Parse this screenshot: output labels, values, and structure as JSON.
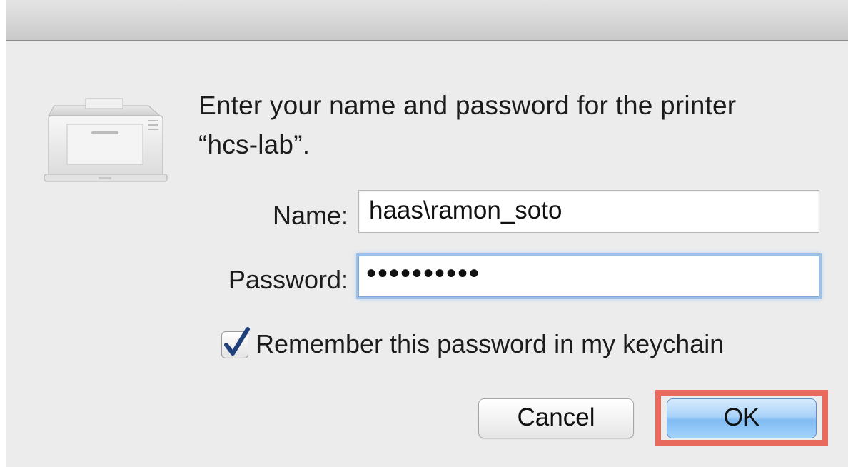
{
  "dialog": {
    "message_line1": "Enter your name and password for the printer",
    "message_line2": "“hcs-lab”."
  },
  "form": {
    "name_label": "Name:",
    "name_value": "haas\\ramon_soto",
    "password_label": "Password:",
    "password_value": "••••••••••",
    "remember_label": "Remember this password in my keychain",
    "remember_checked": true
  },
  "buttons": {
    "cancel_label": "Cancel",
    "ok_label": "OK"
  },
  "icons": {
    "app_icon": "printer-icon",
    "check_icon": "checkmark-icon"
  },
  "colors": {
    "highlight": "#e86a5c",
    "focus_ring": "#9cc0ea",
    "default_button": "#a9d2f8"
  }
}
